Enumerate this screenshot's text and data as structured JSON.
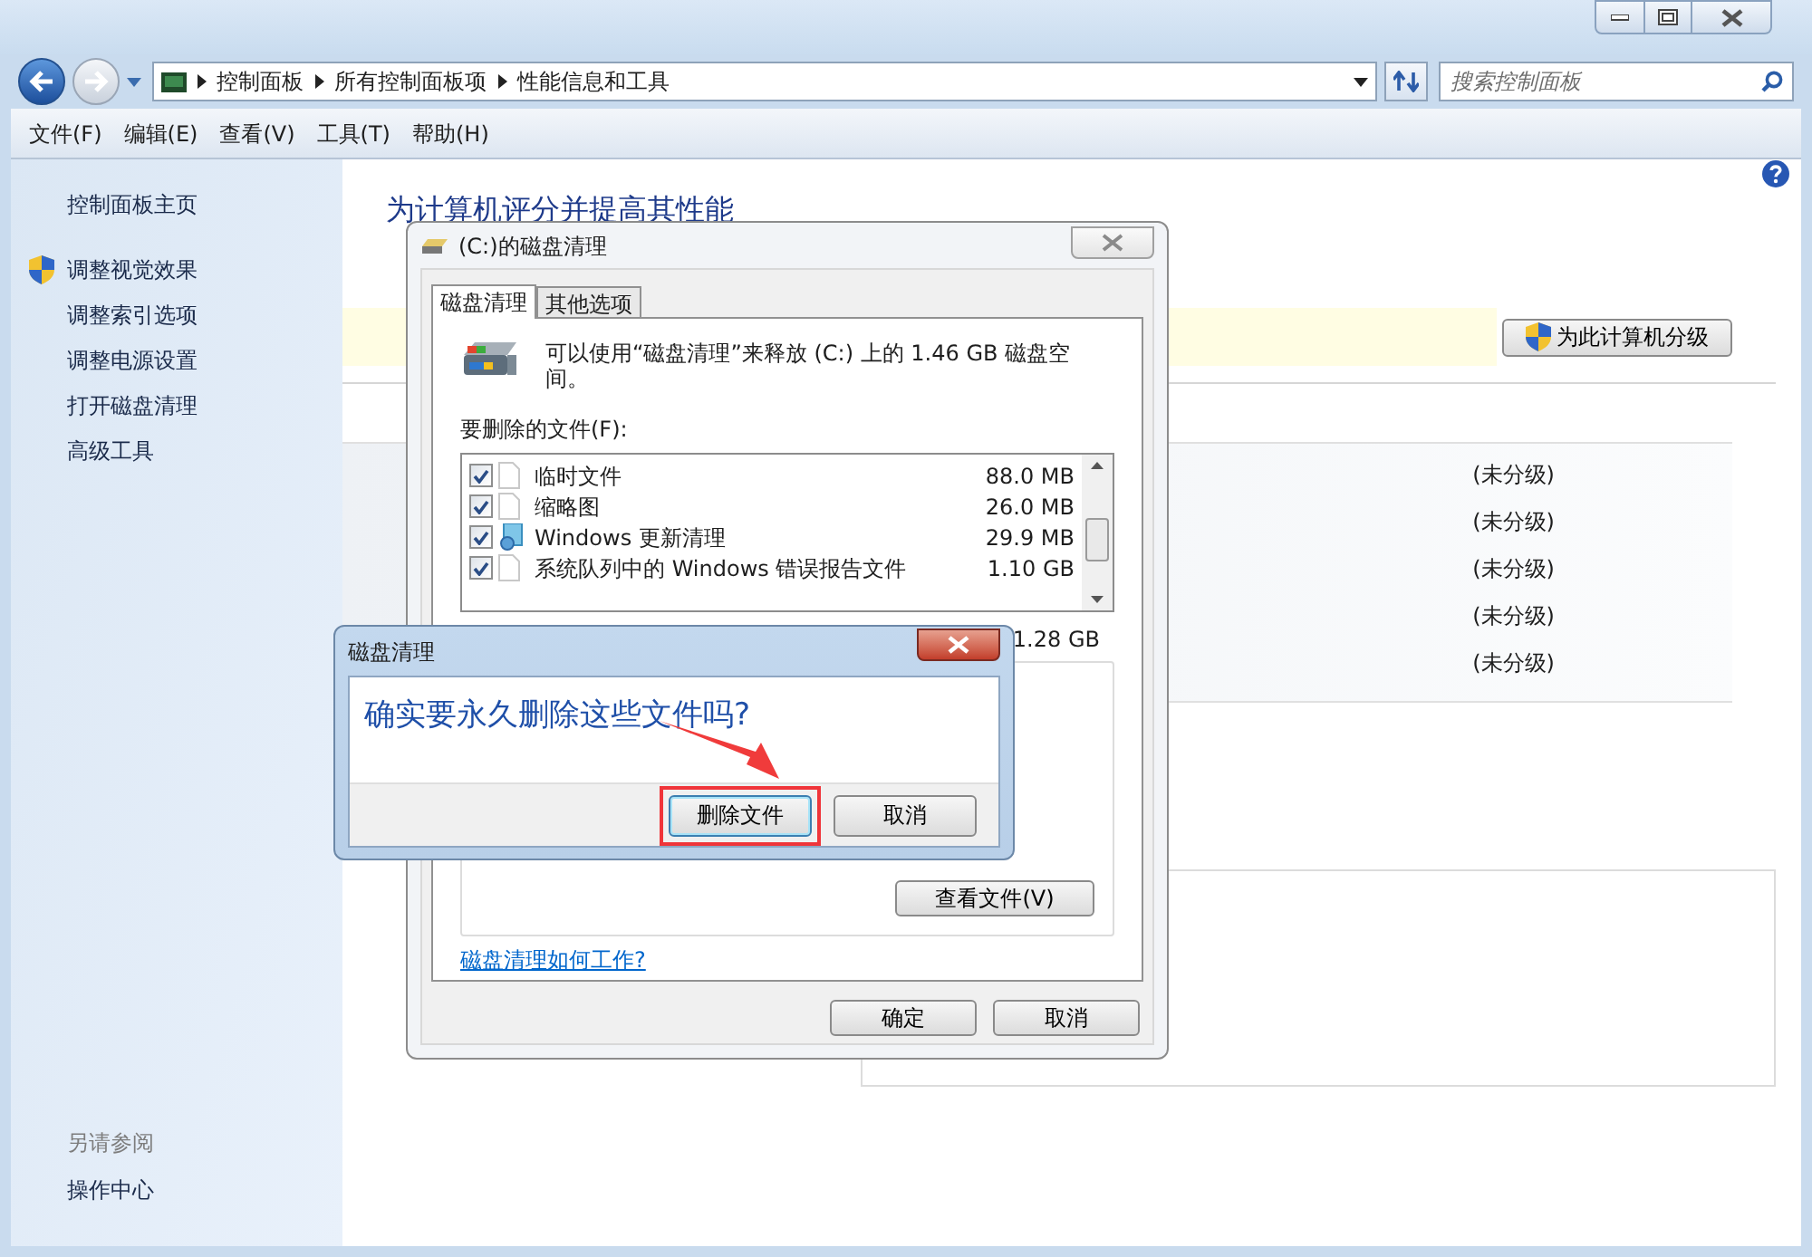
{
  "address_bar": {
    "breadcrumbs": [
      "控制面板",
      "所有控制面板项",
      "性能信息和工具"
    ]
  },
  "search": {
    "placeholder": "搜索控制面板"
  },
  "menu": [
    "文件(F)",
    "编辑(E)",
    "查看(V)",
    "工具(T)",
    "帮助(H)"
  ],
  "sidebar": {
    "items": [
      {
        "label": "控制面板主页",
        "kind": "home"
      },
      {
        "label": "调整视觉效果",
        "kind": "shield"
      },
      {
        "label": "调整索引选项",
        "kind": "link"
      },
      {
        "label": "调整电源设置",
        "kind": "link"
      },
      {
        "label": "打开磁盘清理",
        "kind": "link"
      },
      {
        "label": "高级工具",
        "kind": "link"
      }
    ],
    "see_also": {
      "heading": "另请参阅",
      "items": [
        "操作中心"
      ]
    }
  },
  "content": {
    "title": "为计算机评分并提高其性能",
    "rate_button": "为此计算机分级",
    "ratings": [
      "(未分级)",
      "(未分级)",
      "(未分级)",
      "(未分级)",
      "(未分级)"
    ]
  },
  "cleanup_dialog": {
    "title": "(C:)的磁盘清理",
    "tabs": [
      {
        "label": "磁盘清理",
        "selected": true
      },
      {
        "label": "其他选项",
        "selected": false
      }
    ],
    "description": "可以使用“磁盘清理”来释放 (C:) 上的 1.46 GB 磁盘空间。",
    "files_label": "要删除的文件(F):",
    "files": [
      {
        "name": "临时文件",
        "size": "88.0 MB",
        "checked": true,
        "kind": "file"
      },
      {
        "name": "缩略图",
        "size": "26.0 MB",
        "checked": true,
        "kind": "file"
      },
      {
        "name": "Windows 更新清理",
        "size": "29.9 MB",
        "checked": true,
        "kind": "update"
      },
      {
        "name": "系统队列中的 Windows 错误报告文件",
        "size": "1.10 GB",
        "checked": true,
        "kind": "file"
      }
    ],
    "total": "1.28 GB",
    "view_files_button": "查看文件(V)",
    "help_link": "磁盘清理如何工作?",
    "buttons": [
      "确定",
      "取消"
    ]
  },
  "confirm_dialog": {
    "title": "磁盘清理",
    "question": "确实要永久删除这些文件吗?",
    "buttons": [
      {
        "label": "删除文件",
        "highlighted": true
      },
      {
        "label": "取消",
        "highlighted": false
      }
    ]
  }
}
